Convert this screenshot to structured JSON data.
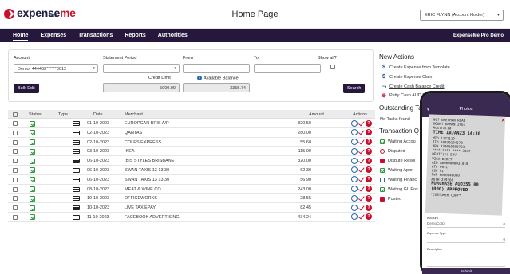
{
  "brand": {
    "name_part1": "expense",
    "name_part2": "me",
    "sub": "PRO"
  },
  "header": {
    "title": "Home Page",
    "user": "ERIC FLYNN (Account Holder)"
  },
  "nav": {
    "items": [
      "Home",
      "Expenses",
      "Transactions",
      "Reports",
      "Authorities"
    ],
    "right": "ExpenseMe Pro Demo"
  },
  "filter": {
    "account_label": "Account",
    "account_value": "Demo, 444433******0012",
    "statement_label": "Statement Period",
    "statement_value": "",
    "from_label": "From",
    "to_label": "To",
    "show_all_label": "Show all?",
    "credit_limit_label": "Credit Limit",
    "credit_limit_value": "5000.00",
    "available_balance_label": "Available Balance",
    "available_balance_value": "3355.74",
    "bulk_edit": "Bulk Edit",
    "search": "Search"
  },
  "table": {
    "headers": [
      "Status",
      "Type",
      "Date",
      "Merchant",
      "Amount",
      "Actions"
    ],
    "rows": [
      {
        "date": "01-10-2023",
        "merchant": "EUROPCAR BRIS A/P",
        "amount": "820.50"
      },
      {
        "date": "02-10-2023",
        "merchant": "QANTAS",
        "amount": "280.00"
      },
      {
        "date": "02-10-2023",
        "merchant": "COLES EXPRESS",
        "amount": "55.60"
      },
      {
        "date": "03-10-2023",
        "merchant": "IKEA",
        "amount": "115.00"
      },
      {
        "date": "06-10-2023",
        "merchant": "IBIS STYLES BRISBANE",
        "amount": "320.00"
      },
      {
        "date": "06-10-2023",
        "merchant": "SWAN TAXIS 13 13 30",
        "amount": "62.30"
      },
      {
        "date": "06-10-2023",
        "merchant": "SWAN TAXIS 13 13 30",
        "amount": "56.90"
      },
      {
        "date": "08-10-2023",
        "merchant": "MEAT & WINE CO",
        "amount": "243.00"
      },
      {
        "date": "10-10-2023",
        "merchant": "OFFICEWORKS",
        "amount": "28.55"
      },
      {
        "date": "10-10-2023",
        "merchant": "LIVE TAXIEPAY",
        "amount": "82.45"
      },
      {
        "date": "11-10-2023",
        "merchant": "FACEBOOK ADVERTISING",
        "amount": "434.24"
      }
    ]
  },
  "new_actions": {
    "title": "New Actions",
    "items": [
      "Create Expense from Template",
      "Create Expense Claim",
      "Create Cash Balance Credit",
      "Petty Cash AUD Bal"
    ]
  },
  "outstanding": {
    "title": "Outstanding Ta",
    "empty": "No Tasks found"
  },
  "transaction_queue": {
    "title": "Transaction Q",
    "items": [
      "Waiting Accou",
      "Disputed",
      "Dispute Resol",
      "Waiting Appr",
      "Waiting Financ",
      "Waiting GL Pos",
      "Posted"
    ]
  },
  "phone": {
    "title": "Photos",
    "receipt_lines": [
      "967 GRETHAN ROAD",
      "MOUNT KNMAN 2967",
      "Australia",
      "TIME 10JAN23  14:30",
      "MID          1171119",
      "TID          10030104578",
      "RRN          230010008783",
      "**** **** **** 3847",
      "DEBIT(S)         SAV",
      "VISA DEBIT",
      "AID       A0000000031010",
      "ATC              001C",
      "CSN                01",
      "TVR        0000048000",
      "AUTH          239366",
      "PURCHASE   AUD355.80",
      "(000) APPROVED",
      "*CUSTOMER COPY*"
    ],
    "account_label": "Account",
    "account_value": "DemoCorp",
    "expense_type_label": "Expense Type",
    "description_label": "Description",
    "zero": "0",
    "footer": "Submit"
  }
}
